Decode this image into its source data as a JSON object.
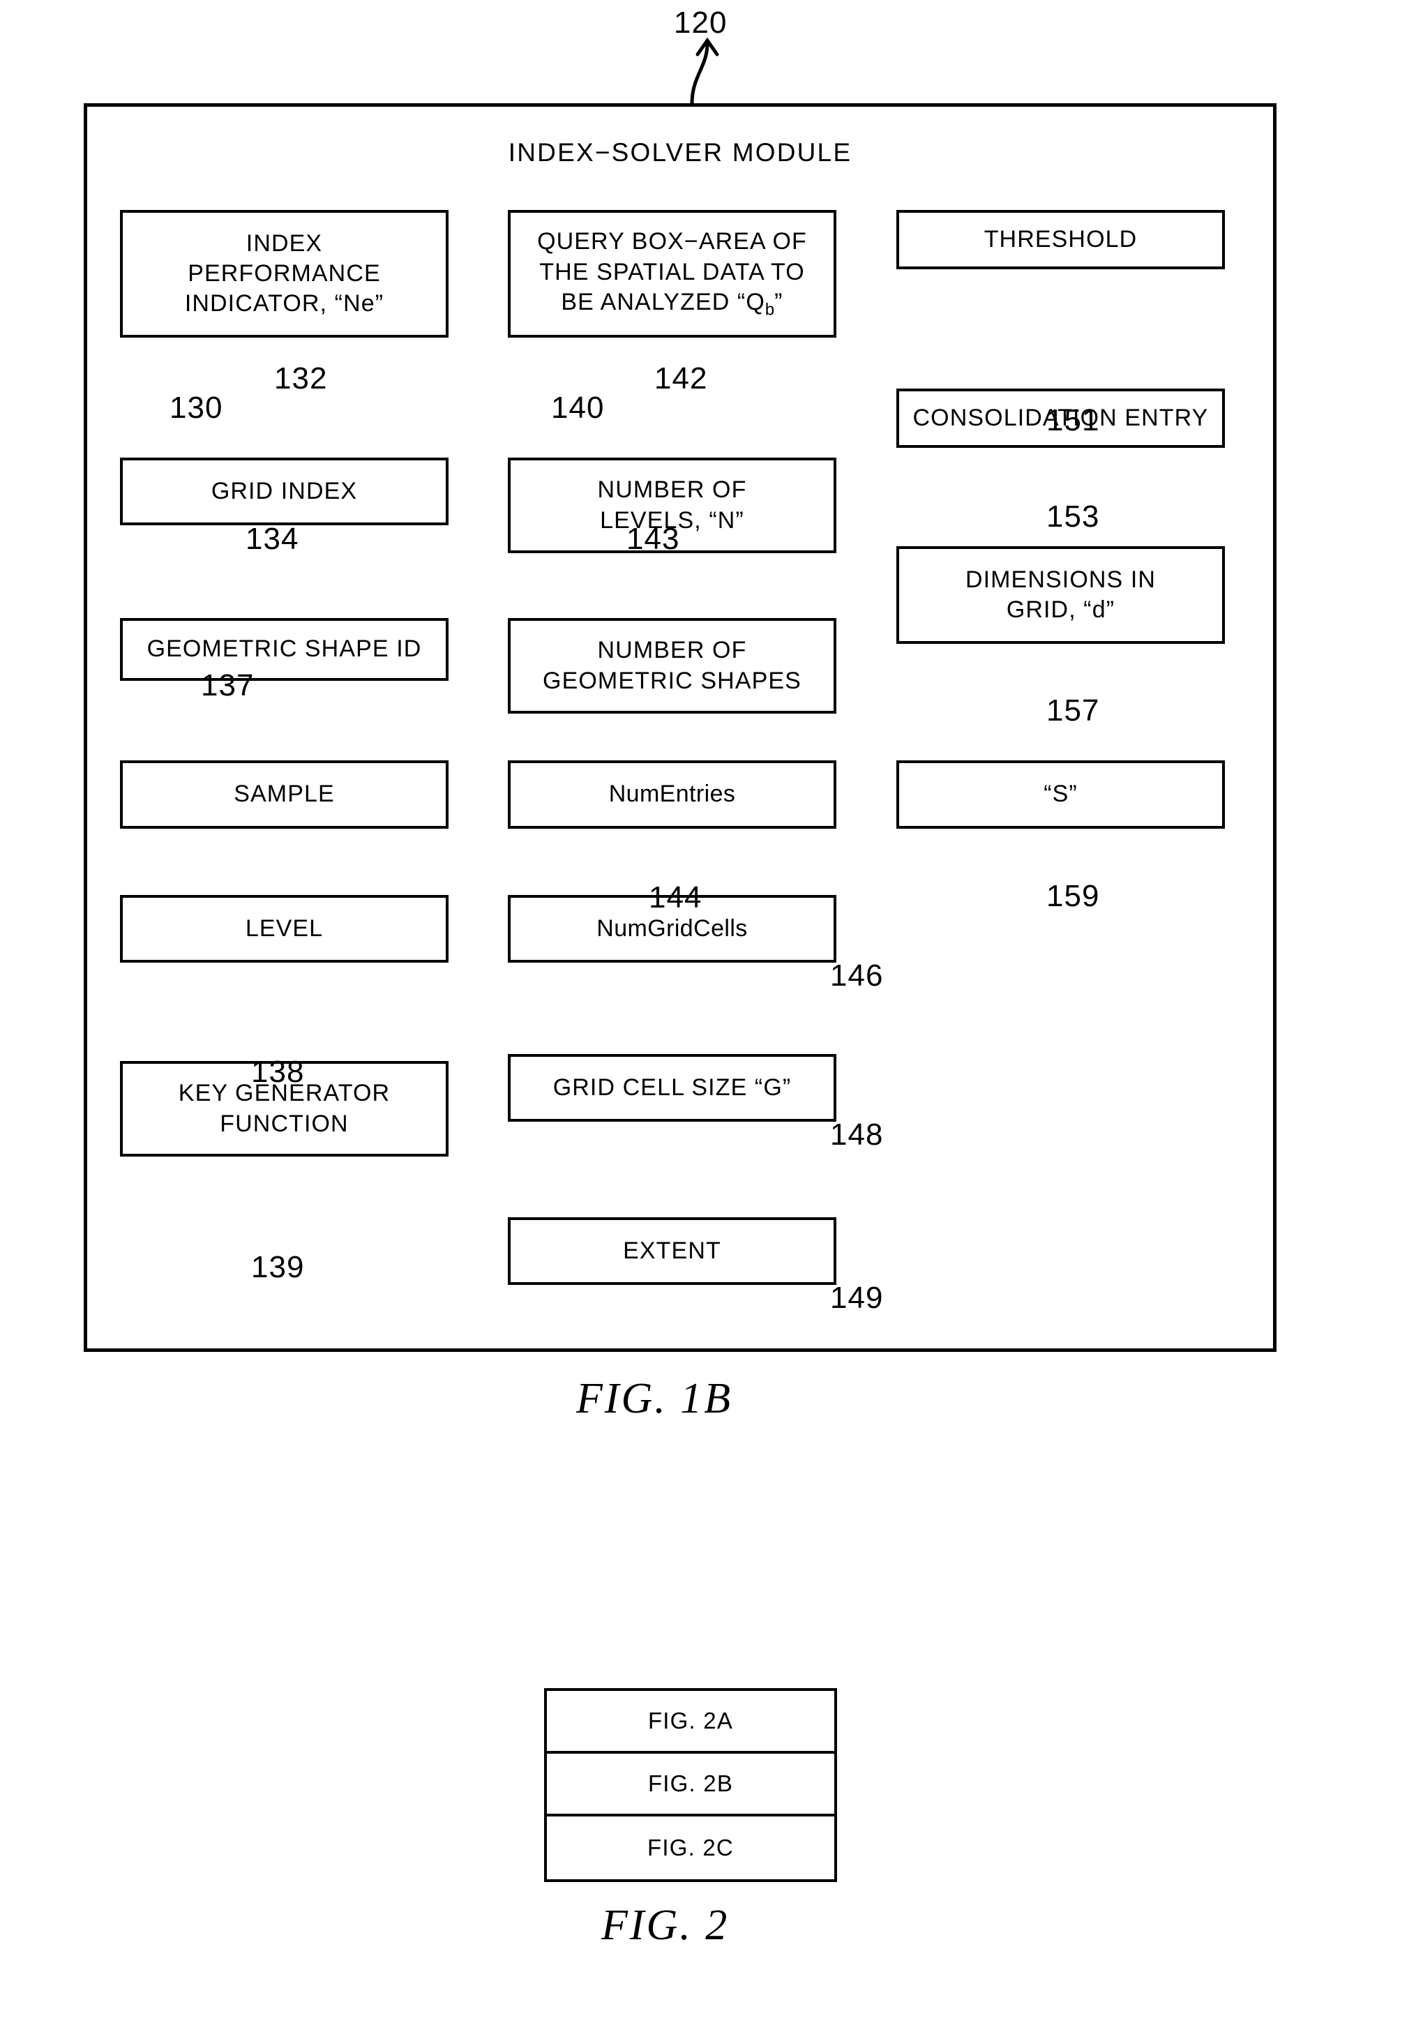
{
  "figure": {
    "top_reference": "120",
    "module_title": "INDEX−SOLVER MODULE",
    "caption_1b": "FIG.  1B",
    "caption_2": "FIG.  2"
  },
  "columns": {
    "left": {
      "boxes": [
        {
          "id": "index-performance-indicator",
          "label": "INDEX\nPERFORMANCE\nINDICATOR, “Ne”"
        },
        {
          "id": "grid-index",
          "label": "GRID INDEX"
        },
        {
          "id": "geometric-shape-id",
          "label": "GEOMETRIC SHAPE ID"
        },
        {
          "id": "sample",
          "label": "SAMPLE"
        },
        {
          "id": "level",
          "label": "LEVEL"
        },
        {
          "id": "key-generator-function",
          "label": "KEY GENERATOR\nFUNCTION"
        }
      ],
      "references": [
        "130",
        "132",
        "134",
        "137",
        "138",
        "139"
      ]
    },
    "middle": {
      "boxes": [
        {
          "id": "query-box-area",
          "label_pre": "QUERY BOX−AREA OF\nTHE SPATIAL DATA TO\nBE ANALYZED “Q",
          "label_sub": "b",
          "label_post": "”"
        },
        {
          "id": "number-of-levels",
          "label": "NUMBER OF\nLEVELS, “N”"
        },
        {
          "id": "number-of-geometric-shapes",
          "label": "NUMBER OF\nGEOMETRIC SHAPES"
        },
        {
          "id": "num-entries",
          "label": "NumEntries"
        },
        {
          "id": "num-grid-cells",
          "label": "NumGridCells"
        },
        {
          "id": "grid-cell-size",
          "label": "GRID CELL SIZE “G”"
        },
        {
          "id": "extent",
          "label": "EXTENT"
        }
      ],
      "references": [
        "140",
        "142",
        "143",
        "144",
        "146",
        "148",
        "149"
      ]
    },
    "right": {
      "boxes": [
        {
          "id": "threshold",
          "label": "THRESHOLD"
        },
        {
          "id": "consolidation-entry",
          "label": "CONSOLIDATION ENTRY"
        },
        {
          "id": "dimensions-in-grid",
          "label": "DIMENSIONS IN\nGRID, “d”"
        },
        {
          "id": "s-parameter",
          "label": "“S”"
        }
      ],
      "references": [
        "151",
        "153",
        "157",
        "159"
      ]
    }
  },
  "sheet_key": {
    "rows": [
      "FIG. 2A",
      "FIG. 2B",
      "FIG. 2C"
    ]
  }
}
